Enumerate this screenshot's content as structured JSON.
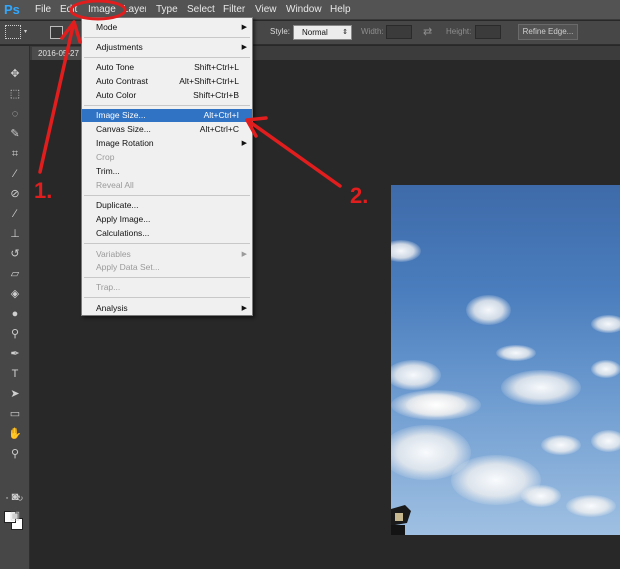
{
  "app": {
    "logo": "Ps"
  },
  "menubar": {
    "items": [
      "File",
      "Edit",
      "Image",
      "Layer",
      "Type",
      "Select",
      "Filter",
      "View",
      "Window",
      "Help"
    ]
  },
  "options": {
    "style_label": "Style:",
    "style_value": "Normal",
    "width_label": "Width:",
    "height_label": "Height:",
    "refine_edge_label": "Refine Edge..."
  },
  "document": {
    "tab_label": "2016-05-27"
  },
  "image_menu": {
    "items": [
      {
        "label": "Mode",
        "shortcut": "",
        "submenu": true,
        "enabled": true
      },
      {
        "label": "Adjustments",
        "shortcut": "",
        "submenu": true,
        "enabled": true
      },
      {
        "label": "Auto Tone",
        "shortcut": "Shift+Ctrl+L",
        "submenu": false,
        "enabled": true
      },
      {
        "label": "Auto Contrast",
        "shortcut": "Alt+Shift+Ctrl+L",
        "submenu": false,
        "enabled": true
      },
      {
        "label": "Auto Color",
        "shortcut": "Shift+Ctrl+B",
        "submenu": false,
        "enabled": true
      },
      {
        "label": "Image Size...",
        "shortcut": "Alt+Ctrl+I",
        "submenu": false,
        "enabled": true,
        "highlighted": true
      },
      {
        "label": "Canvas Size...",
        "shortcut": "Alt+Ctrl+C",
        "submenu": false,
        "enabled": true
      },
      {
        "label": "Image Rotation",
        "shortcut": "",
        "submenu": true,
        "enabled": true
      },
      {
        "label": "Crop",
        "shortcut": "",
        "submenu": false,
        "enabled": false
      },
      {
        "label": "Trim...",
        "shortcut": "",
        "submenu": false,
        "enabled": true
      },
      {
        "label": "Reveal All",
        "shortcut": "",
        "submenu": false,
        "enabled": false
      },
      {
        "label": "Duplicate...",
        "shortcut": "",
        "submenu": false,
        "enabled": true
      },
      {
        "label": "Apply Image...",
        "shortcut": "",
        "submenu": false,
        "enabled": true
      },
      {
        "label": "Calculations...",
        "shortcut": "",
        "submenu": false,
        "enabled": true
      },
      {
        "label": "Variables",
        "shortcut": "",
        "submenu": true,
        "enabled": false
      },
      {
        "label": "Apply Data Set...",
        "shortcut": "",
        "submenu": false,
        "enabled": false
      },
      {
        "label": "Trap...",
        "shortcut": "",
        "submenu": false,
        "enabled": false
      },
      {
        "label": "Analysis",
        "shortcut": "",
        "submenu": true,
        "enabled": true
      }
    ]
  },
  "annotations": {
    "step1": "1.",
    "step2": "2."
  },
  "colors": {
    "accent_red": "#e21d1d",
    "menu_highlight": "#3072c4",
    "ps_blue": "#31a8ff"
  },
  "tools": [
    "move-icon",
    "marquee-icon",
    "lasso-icon",
    "quick-select-icon",
    "crop-icon",
    "eyedropper-icon",
    "healing-brush-icon",
    "brush-icon",
    "clone-stamp-icon",
    "history-brush-icon",
    "eraser-icon",
    "gradient-icon",
    "blur-icon",
    "dodge-icon",
    "pen-icon",
    "type-icon",
    "path-select-icon",
    "rectangle-icon",
    "hand-icon",
    "zoom-icon"
  ]
}
